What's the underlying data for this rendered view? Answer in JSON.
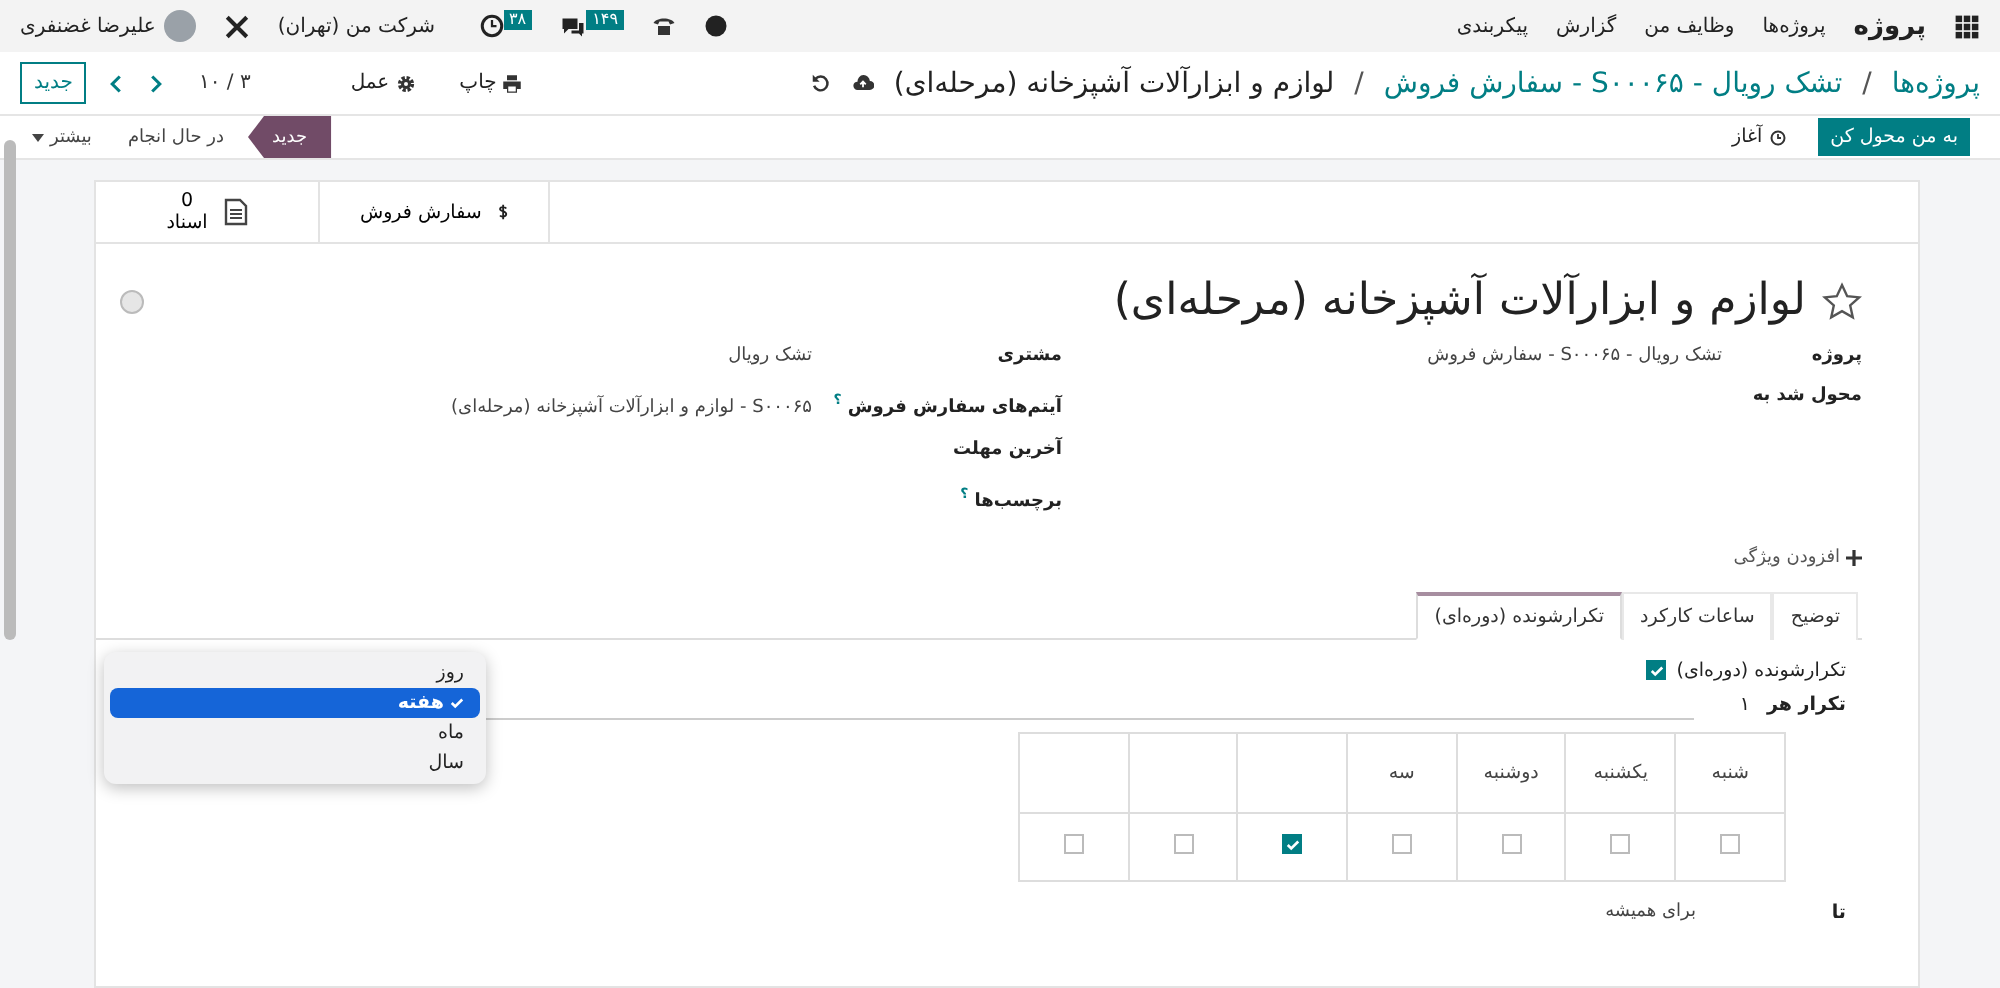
{
  "navbar": {
    "app_name": "پروژه",
    "menu": [
      "پروژه‌ها",
      "وظایف من",
      "گزارش",
      "پیکربندی"
    ],
    "messages_badge": "۱۴۹",
    "activities_badge": "۳۸",
    "company": "شرکت من (تهران)",
    "user": "علیرضا غضنفری"
  },
  "control_panel": {
    "breadcrumb": {
      "separator": "/",
      "items": [
        {
          "label": "پروژه‌ها",
          "kind": "link"
        },
        {
          "label": "تشک رویال - S۰۰۰۶۵ - سفارش فروش",
          "kind": "link"
        },
        {
          "label": "لوازم و ابزارآلات آشپزخانه (مرحله‌ای)",
          "kind": "current"
        }
      ]
    },
    "actions": [
      {
        "label": "چاپ",
        "kind": "print"
      },
      {
        "label": "عمل",
        "kind": "gear"
      }
    ],
    "pager": "۳ / ۱۰",
    "new_button": "جدید"
  },
  "status_bar": {
    "buttons": [
      {
        "label": "به من محول کن",
        "kind": "primary"
      },
      {
        "label": "آغاز",
        "kind": "clock"
      }
    ],
    "stages": [
      {
        "label": "جدید",
        "selected": true
      },
      {
        "label": "در حال انجام",
        "selected": false
      }
    ],
    "more": "بیشتر"
  },
  "smart_buttons": [
    {
      "kind": "dollar",
      "label": "سفارش فروش"
    },
    {
      "kind": "document",
      "label": "اسناد",
      "count": "0"
    }
  ],
  "title": "لوازم و ابزارآلات آشپزخانه (مرحله‌ای)",
  "starred": false,
  "fields_right": [
    {
      "label": "پروژه",
      "value": "تشک رویال - S۰۰۰۶۵ - سفارش فروش"
    },
    {
      "label": "محول شد به"
    }
  ],
  "fields_left": [
    {
      "label": "مشتری",
      "value": "تشک رویال"
    },
    {
      "label": "آیتم‌های سفارش فروش",
      "help_mark": "؟",
      "value": "S۰۰۰۶۵ - لوازم و ابزارآلات آشپزخانه (مرحله‌ای)"
    },
    {
      "label": "آخرین مهلت"
    },
    {
      "label": "برچسب‌ها",
      "help_mark": "؟"
    }
  ],
  "add_property": "افزودن ویژگی",
  "tabs": [
    {
      "label": "توضیح",
      "selected": false
    },
    {
      "label": "ساعات کارکرد",
      "selected": false
    },
    {
      "label": "تکرارشونده (دوره‌ای)",
      "selected": true
    }
  ],
  "recurrence": {
    "label": "تکرارشونده (دوره‌ای)",
    "checked": true,
    "repeat_label": "تکرار هر",
    "interval": "۱",
    "unit_menu": [
      {
        "label": "روز",
        "selected": false
      },
      {
        "label": "هفته",
        "selected": true
      },
      {
        "label": "ماه",
        "selected": false
      },
      {
        "label": "سال",
        "selected": false
      }
    ],
    "weekdays": [
      {
        "label": "شنبه",
        "checked": false
      },
      {
        "label": "یکشنبه",
        "checked": false
      },
      {
        "label": "دوشنبه",
        "checked": false
      },
      {
        "label": "سه",
        "checked": false
      },
      {
        "checked": true
      },
      {
        "checked": false
      },
      {
        "checked": false
      }
    ],
    "until_label": "تا",
    "until_value": "برای همیشه"
  }
}
